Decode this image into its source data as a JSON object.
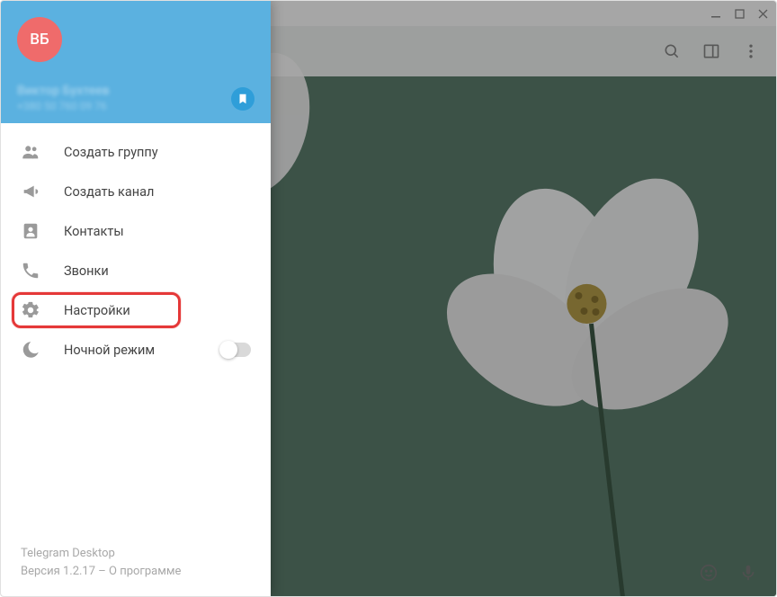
{
  "titlebar": {
    "min": "—",
    "max": "☐",
    "close": "✕"
  },
  "drawer": {
    "avatar_initials": "ВБ",
    "user_name": "Виктор Бухтеев",
    "user_phone": "+380 50 760 09 76",
    "menu": {
      "create_group": "Создать группу",
      "create_channel": "Создать канал",
      "contacts": "Контакты",
      "calls": "Звонки",
      "settings": "Настройки",
      "night_mode": "Ночной режим"
    },
    "footer": {
      "app_name": "Telegram Desktop",
      "version_label": "Версия 1.2.17",
      "about_sep": " – ",
      "about_label": "О программе"
    }
  },
  "night_mode_on": false
}
